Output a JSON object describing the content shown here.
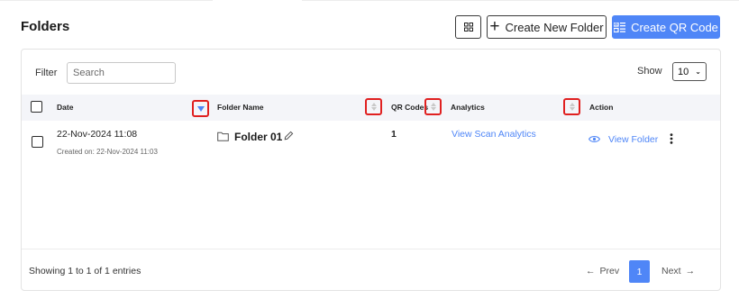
{
  "header": {
    "title": "Folders",
    "new_folder_label": "Create New Folder",
    "create_qr_label": "Create QR Code"
  },
  "filter": {
    "label": "Filter",
    "placeholder": "Search",
    "value": ""
  },
  "show": {
    "label": "Show",
    "selected": "10"
  },
  "table": {
    "columns": [
      "Date",
      "Folder Name",
      "QR Codes",
      "Analytics",
      "Action"
    ],
    "rows": [
      {
        "date": "22-Nov-2024 11:08",
        "created": "Created on: 22-Nov-2024 11:03",
        "folder_name": "Folder 01",
        "qr_codes": "1",
        "analytics_link": "View Scan Analytics",
        "action_link": "View Folder"
      }
    ]
  },
  "footer": {
    "summary": "Showing 1 to 1 of 1 entries",
    "prev": "Prev",
    "current_page": "1",
    "next": "Next"
  },
  "colors": {
    "accent": "#4f86f7",
    "highlight_border": "#e02020"
  }
}
